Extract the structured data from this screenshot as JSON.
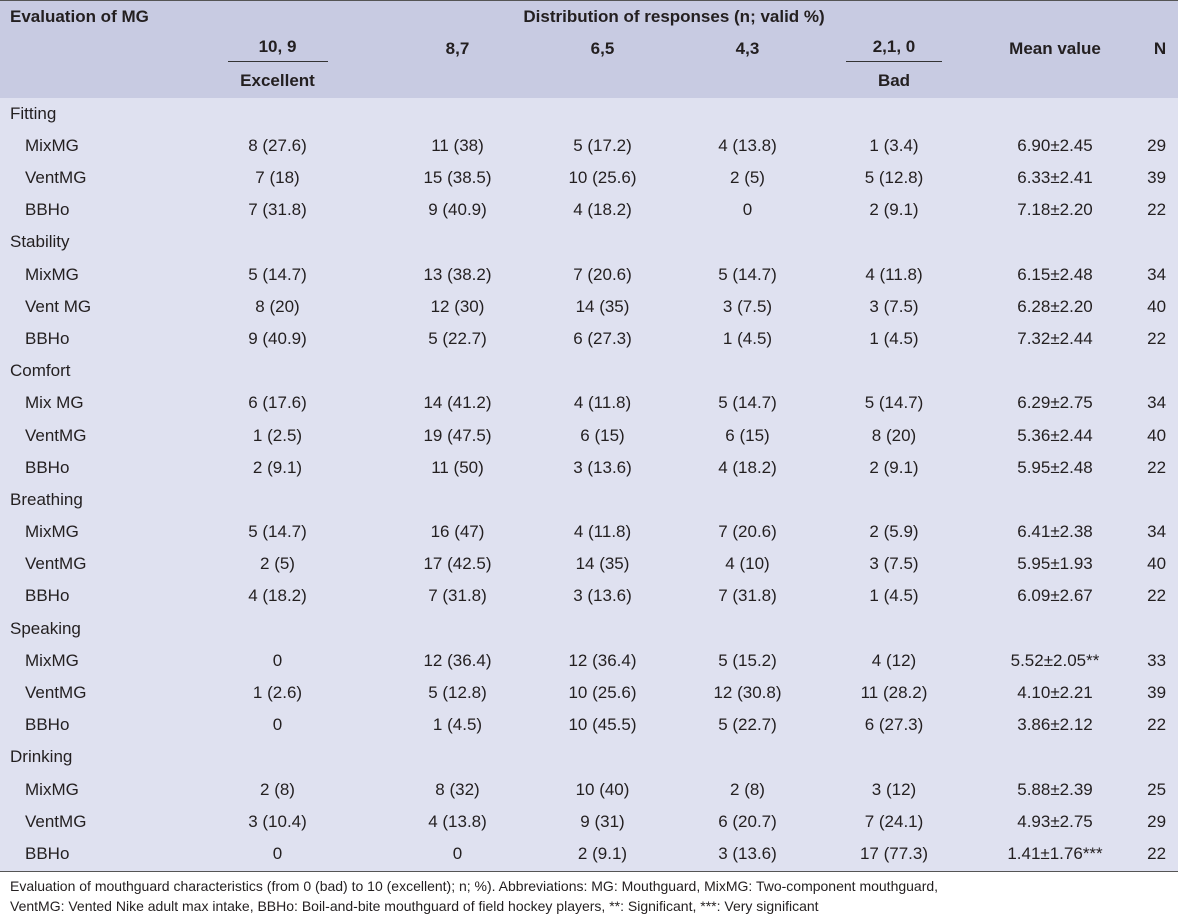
{
  "header": {
    "label_col": "Evaluation of MG",
    "distribution": "Distribution of responses (n; valid %)",
    "score_cols": [
      "10, 9",
      "8,7",
      "6,5",
      "4,3",
      "2,1, 0"
    ],
    "mean_col": "Mean value",
    "n_col": "N",
    "excellent": "Excellent",
    "bad": "Bad"
  },
  "sections": [
    {
      "title": "Fitting",
      "rows": [
        {
          "label": "MixMG",
          "cells": [
            "8 (27.6)",
            "11 (38)",
            "5 (17.2)",
            "4 (13.8)",
            "1 (3.4)"
          ],
          "mean": "6.90±2.45",
          "n": "29"
        },
        {
          "label": "VentMG",
          "cells": [
            "7 (18)",
            "15 (38.5)",
            "10 (25.6)",
            "2 (5)",
            "5 (12.8)"
          ],
          "mean": "6.33±2.41",
          "n": "39"
        },
        {
          "label": "BBHo",
          "cells": [
            "7 (31.8)",
            "9 (40.9)",
            "4 (18.2)",
            "0",
            "2 (9.1)"
          ],
          "mean": "7.18±2.20",
          "n": "22"
        }
      ]
    },
    {
      "title": "Stability",
      "rows": [
        {
          "label": "MixMG",
          "cells": [
            "5 (14.7)",
            "13 (38.2)",
            "7 (20.6)",
            "5 (14.7)",
            "4 (11.8)"
          ],
          "mean": "6.15±2.48",
          "n": "34"
        },
        {
          "label": "Vent MG",
          "cells": [
            "8 (20)",
            "12 (30)",
            "14 (35)",
            "3 (7.5)",
            "3 (7.5)"
          ],
          "mean": "6.28±2.20",
          "n": "40"
        },
        {
          "label": "BBHo",
          "cells": [
            "9 (40.9)",
            "5 (22.7)",
            "6 (27.3)",
            "1 (4.5)",
            "1 (4.5)"
          ],
          "mean": "7.32±2.44",
          "n": "22"
        }
      ]
    },
    {
      "title": "Comfort",
      "rows": [
        {
          "label": "Mix MG",
          "cells": [
            "6 (17.6)",
            "14 (41.2)",
            "4 (11.8)",
            "5 (14.7)",
            "5 (14.7)"
          ],
          "mean": "6.29±2.75",
          "n": "34"
        },
        {
          "label": "VentMG",
          "cells": [
            "1 (2.5)",
            "19 (47.5)",
            "6 (15)",
            "6 (15)",
            "8 (20)"
          ],
          "mean": "5.36±2.44",
          "n": "40"
        },
        {
          "label": "BBHo",
          "cells": [
            "2 (9.1)",
            "11 (50)",
            "3 (13.6)",
            "4 (18.2)",
            "2 (9.1)"
          ],
          "mean": "5.95±2.48",
          "n": "22"
        }
      ]
    },
    {
      "title": "Breathing",
      "rows": [
        {
          "label": "MixMG",
          "cells": [
            "5 (14.7)",
            "16 (47)",
            "4 (11.8)",
            "7 (20.6)",
            "2 (5.9)"
          ],
          "mean": "6.41±2.38",
          "n": "34"
        },
        {
          "label": "VentMG",
          "cells": [
            "2 (5)",
            "17 (42.5)",
            "14 (35)",
            "4 (10)",
            "3 (7.5)"
          ],
          "mean": "5.95±1.93",
          "n": "40"
        },
        {
          "label": "BBHo",
          "cells": [
            "4 (18.2)",
            "7 (31.8)",
            "3 (13.6)",
            "7 (31.8)",
            "1 (4.5)"
          ],
          "mean": "6.09±2.67",
          "n": "22"
        }
      ]
    },
    {
      "title": "Speaking",
      "rows": [
        {
          "label": "MixMG",
          "cells": [
            "0",
            "12 (36.4)",
            "12 (36.4)",
            "5 (15.2)",
            "4 (12)"
          ],
          "mean": "5.52±2.05**",
          "n": "33"
        },
        {
          "label": "VentMG",
          "cells": [
            "1 (2.6)",
            "5 (12.8)",
            "10 (25.6)",
            "12 (30.8)",
            "11 (28.2)"
          ],
          "mean": "4.10±2.21",
          "n": "39"
        },
        {
          "label": "BBHo",
          "cells": [
            "0",
            "1 (4.5)",
            "10 (45.5)",
            "5 (22.7)",
            "6 (27.3)"
          ],
          "mean": "3.86±2.12",
          "n": "22"
        }
      ]
    },
    {
      "title": "Drinking",
      "rows": [
        {
          "label": "MixMG",
          "cells": [
            "2 (8)",
            "8 (32)",
            "10 (40)",
            "2 (8)",
            "3 (12)"
          ],
          "mean": "5.88±2.39",
          "n": "25"
        },
        {
          "label": "VentMG",
          "cells": [
            "3 (10.4)",
            "4 (13.8)",
            "9 (31)",
            "6 (20.7)",
            "7 (24.1)"
          ],
          "mean": "4.93±2.75",
          "n": "29"
        },
        {
          "label": "BBHo",
          "cells": [
            "0",
            "0",
            "2 (9.1)",
            "3 (13.6)",
            "17 (77.3)"
          ],
          "mean": "1.41±1.76***",
          "n": "22"
        }
      ]
    }
  ],
  "caption": {
    "line1": "Evaluation of mouthguard characteristics (from 0 (bad) to 10 (excellent); n; %). Abbreviations: MG: Mouthguard, MixMG: Two-component mouthguard,",
    "line2": "VentMG: Vented Nike adult max intake, BBHo: Boil-and-bite mouthguard of field hockey players, **: Significant, ***: Very significant"
  }
}
